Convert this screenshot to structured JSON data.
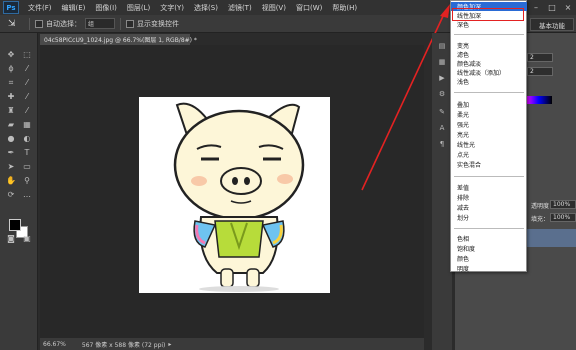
{
  "app": {
    "logo": "Ps"
  },
  "menu": [
    "文件(F)",
    "编辑(E)",
    "图像(I)",
    "图层(L)",
    "文字(Y)",
    "选择(S)",
    "滤镜(T)",
    "视图(V)",
    "窗口(W)",
    "帮助(H)"
  ],
  "window_controls": [
    "–",
    "□",
    "×"
  ],
  "options": {
    "auto_select_label": "自动选择：",
    "auto_select_value": "组",
    "show_transform_label": "显示变换控件"
  },
  "workspace_button": "基本功能",
  "document_tab": "04c58PICcU9_1024.jpg @ 66.7%(图层 1, RGB/8#) *",
  "status": {
    "zoom": "66.67%",
    "size": "567 像素 x 588 像素 (72 ppi)"
  },
  "right_panel": {
    "opacity_label": "透明度：",
    "opacity_value": "100%",
    "fill_label": "填充：",
    "fill_value": "100%",
    "box_values": [
      "2",
      "2"
    ]
  },
  "blend_menu": {
    "selected": "颜色加深",
    "groups": [
      [
        "颜色加深",
        "线性加深",
        "深色"
      ],
      [
        "变亮",
        "滤色",
        "颜色减淡",
        "线性减淡（添加）",
        "浅色"
      ],
      [
        "叠加",
        "柔光",
        "强光",
        "亮光",
        "线性光",
        "点光",
        "实色混合"
      ],
      [
        "差值",
        "排除",
        "减去",
        "划分"
      ],
      [
        "色相",
        "饱和度",
        "颜色",
        "明度"
      ]
    ]
  },
  "colors": {
    "accent": "#2a6bd5",
    "annotation": "#e32222"
  }
}
